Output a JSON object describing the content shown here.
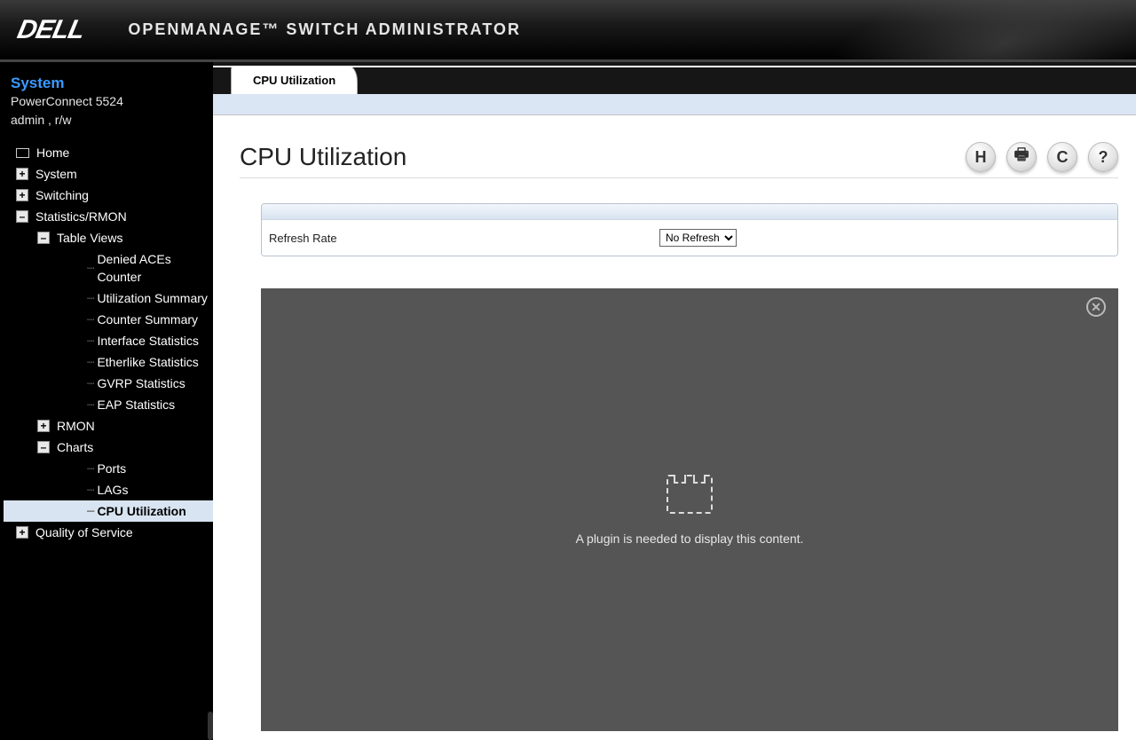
{
  "header": {
    "logo_text": "DELL",
    "title": "OPENMANAGE™ SWITCH ADMINISTRATOR"
  },
  "sidebar": {
    "system_label": "System",
    "device": "PowerConnect 5524",
    "user": "admin , r/w",
    "items": {
      "home": "Home",
      "system": "System",
      "switching": "Switching",
      "stats": "Statistics/RMON",
      "table_views": "Table Views",
      "denied": "Denied ACEs Counter",
      "util_summary": "Utilization Summary",
      "counter_summary": "Counter Summary",
      "iface_stats": "Interface Statistics",
      "ether_stats": "Etherlike Statistics",
      "gvrp": "GVRP Statistics",
      "eap": "EAP Statistics",
      "rmon": "RMON",
      "charts": "Charts",
      "ports": "Ports",
      "lags": "LAGs",
      "cpu": "CPU Utilization",
      "qos": "Quality of Service"
    }
  },
  "tab": {
    "label": "CPU Utilization"
  },
  "page": {
    "title": "CPU Utilization",
    "refresh_label": "Refresh Rate",
    "refresh_selected": "No Refresh",
    "plugin_msg": "A plugin is needed to display this content."
  },
  "icons": {
    "save": "H",
    "print": "🖶",
    "refresh": "C",
    "help": "?"
  }
}
